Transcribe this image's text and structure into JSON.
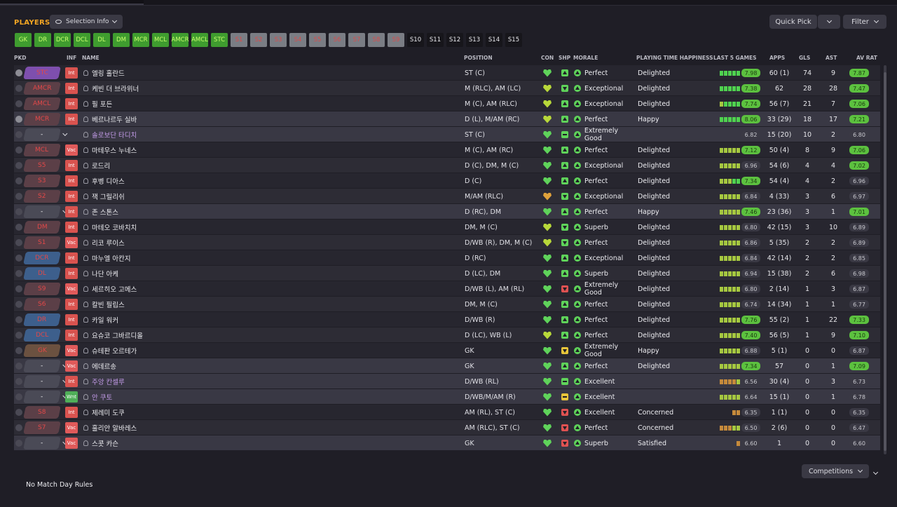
{
  "header": {
    "title": "PLAYERS",
    "selection_info": "Selection Info",
    "quick_pick": "Quick Pick",
    "filter": "Filter"
  },
  "position_chips": [
    {
      "label": "GK",
      "style": "green"
    },
    {
      "label": "DR",
      "style": "green"
    },
    {
      "label": "DCR",
      "style": "green"
    },
    {
      "label": "DCL",
      "style": "green"
    },
    {
      "label": "DL",
      "style": "green"
    },
    {
      "label": "DM",
      "style": "green"
    },
    {
      "label": "MCR",
      "style": "green"
    },
    {
      "label": "MCL",
      "style": "green"
    },
    {
      "label": "AMCR",
      "style": "green"
    },
    {
      "label": "AMCL",
      "style": "green"
    },
    {
      "label": "STC",
      "style": "green"
    },
    {
      "label": "S1",
      "style": "grey"
    },
    {
      "label": "S2",
      "style": "grey"
    },
    {
      "label": "S3",
      "style": "grey"
    },
    {
      "label": "S4",
      "style": "grey"
    },
    {
      "label": "S5",
      "style": "grey"
    },
    {
      "label": "S6",
      "style": "grey"
    },
    {
      "label": "S7",
      "style": "grey"
    },
    {
      "label": "S8",
      "style": "grey"
    },
    {
      "label": "S9",
      "style": "grey"
    },
    {
      "label": "S10",
      "style": "dark"
    },
    {
      "label": "S11",
      "style": "dark"
    },
    {
      "label": "S12",
      "style": "dark"
    },
    {
      "label": "S13",
      "style": "dark"
    },
    {
      "label": "S14",
      "style": "dark"
    },
    {
      "label": "S15",
      "style": "dark"
    }
  ],
  "columns": {
    "pkd": "PKD",
    "inf": "INF",
    "name": "NAME",
    "position": "POSITION",
    "con": "CON",
    "shp": "SHP",
    "morale": "MORALE",
    "happiness": "PLAYING TIME HAPPINESS",
    "last5": "LAST 5 GAMES",
    "apps": "APPS",
    "gls": "GLS",
    "ast": "AST",
    "avrat": "AV RAT"
  },
  "players": [
    {
      "pk": "on",
      "slot": "STC",
      "slot_color": "purple",
      "inf": "Int",
      "name": "엘링 홀란드",
      "pos": "ST (C)",
      "con": "g",
      "shp": "up",
      "morale": "Perfect",
      "happy": "Delighted",
      "form": "ggggg",
      "r5": "7.98",
      "r5g": true,
      "apps": "60 (1)",
      "gls": "74",
      "ast": "9",
      "avr": "7.87",
      "avrg": true,
      "bg": "row"
    },
    {
      "pk": "off",
      "slot": "AMCR",
      "slot_color": "maroon",
      "inf": "Int",
      "name": "케빈 더 브라위너",
      "pos": "M (RLC), AM (LC)",
      "con": "y",
      "shp": "dn",
      "morale": "Exceptional",
      "happy": "Delighted",
      "form": "ggggg",
      "r5": "7.38",
      "r5g": true,
      "apps": "62",
      "gls": "28",
      "ast": "28",
      "avr": "7.47",
      "avrg": true,
      "bg": "alt"
    },
    {
      "pk": "off",
      "slot": "AMCL",
      "slot_color": "maroon",
      "inf": "Int",
      "name": "필 포든",
      "pos": "M (C), AM (RLC)",
      "con": "y",
      "shp": "up",
      "morale": "Exceptional",
      "happy": "Delighted",
      "form": "lgggg",
      "r5": "7.74",
      "r5g": true,
      "apps": "56 (7)",
      "gls": "21",
      "ast": "7",
      "avr": "7.06",
      "avrg": true,
      "bg": "row"
    },
    {
      "pk": "on",
      "slot": "MCR",
      "slot_color": "maroon",
      "inf": "Int",
      "name": "베르나르두 실바",
      "pos": "D (L), M/AM (RC)",
      "con": "y",
      "shp": "up",
      "morale": "Perfect",
      "happy": "Happy",
      "form": "ggggg",
      "r5": "8.06",
      "r5g": true,
      "apps": "33 (29)",
      "gls": "18",
      "ast": "17",
      "avr": "7.21",
      "avrg": true,
      "bg": "hl"
    },
    {
      "pk": "off",
      "slot": "-",
      "slot_color": "slate",
      "inf": "",
      "name": "솔로보단 타디치",
      "pos": "ST (C)",
      "con": "g",
      "shp": "eq",
      "morale": "Extremely Good",
      "happy": "",
      "form": "xxxxx",
      "r5": "6.82",
      "r5g": false,
      "apps": "15 (20)",
      "gls": "10",
      "ast": "2",
      "avr": "6.80",
      "avrg": false,
      "bg": "hl",
      "purple_name": true
    },
    {
      "pk": "off",
      "slot": "MCL",
      "slot_color": "maroon",
      "inf": "Vac",
      "name": "마테우스 누네스",
      "pos": "M (C), AM (RC)",
      "con": "g",
      "shp": "up",
      "morale": "Perfect",
      "happy": "Delighted",
      "form": "lllll",
      "r5": "7.12",
      "r5g": true,
      "apps": "50 (4)",
      "gls": "8",
      "ast": "9",
      "avr": "7.06",
      "avrg": true,
      "bg": "row"
    },
    {
      "pk": "off",
      "slot": "S5",
      "slot_color": "maroon",
      "inf": "Int",
      "name": "로드리",
      "pos": "D (C), DM, M (C)",
      "con": "g",
      "shp": "up",
      "morale": "Exceptional",
      "happy": "Delighted",
      "form": "lllll",
      "r5": "6.96",
      "r5g": false,
      "apps": "54 (6)",
      "gls": "4",
      "ast": "4",
      "avr": "7.02",
      "avrg": true,
      "bg": "alt"
    },
    {
      "pk": "off",
      "slot": "S3",
      "slot_color": "maroon",
      "inf": "Int",
      "name": "후벵 디아스",
      "pos": "D (C)",
      "con": "g",
      "shp": "up",
      "morale": "Perfect",
      "happy": "Delighted",
      "form": "lllgg",
      "r5": "7.34",
      "r5g": true,
      "apps": "54 (4)",
      "gls": "4",
      "ast": "2",
      "avr": "6.96",
      "avrg": false,
      "bg": "row"
    },
    {
      "pk": "off",
      "slot": "S2",
      "slot_color": "maroon",
      "inf": "Int",
      "name": "잭 그릴리쉬",
      "pos": "M/AM (RLC)",
      "con": "o",
      "shp": "dn",
      "morale": "Exceptional",
      "happy": "Delighted",
      "form": "lllll",
      "r5": "6.84",
      "r5g": false,
      "apps": "4 (33)",
      "gls": "3",
      "ast": "6",
      "avr": "6.97",
      "avrg": false,
      "bg": "alt"
    },
    {
      "pk": "off",
      "slot": "-",
      "slot_color": "slate",
      "inf": "Int",
      "name": "존 스톤스",
      "pos": "D (RC), DM",
      "con": "g",
      "shp": "up",
      "morale": "Perfect",
      "happy": "Happy",
      "form": "lllll",
      "r5": "7.46",
      "r5g": true,
      "apps": "23 (36)",
      "gls": "3",
      "ast": "1",
      "avr": "7.01",
      "avrg": true,
      "bg": "hl"
    },
    {
      "pk": "off",
      "slot": "DM",
      "slot_color": "maroon",
      "inf": "Int",
      "name": "마테오 코바치치",
      "pos": "DM, M (C)",
      "con": "y",
      "shp": "dn",
      "morale": "Superb",
      "happy": "Delighted",
      "form": "lllll",
      "r5": "6.80",
      "r5g": false,
      "apps": "42 (15)",
      "gls": "3",
      "ast": "10",
      "avr": "6.89",
      "avrg": false,
      "bg": "row"
    },
    {
      "pk": "off",
      "slot": "S1",
      "slot_color": "maroon",
      "inf": "Vac",
      "name": "리코 루이스",
      "pos": "D/WB (R), DM, M (C)",
      "con": "y",
      "shp": "dn",
      "morale": "Perfect",
      "happy": "Delighted",
      "form": "lllll",
      "r5": "6.86",
      "r5g": false,
      "apps": "5 (35)",
      "gls": "2",
      "ast": "2",
      "avr": "6.89",
      "avrg": false,
      "bg": "alt"
    },
    {
      "pk": "off",
      "slot": "DCR",
      "slot_color": "blue",
      "inf": "Int",
      "name": "마누엘 아칸지",
      "pos": "D (RC)",
      "con": "g",
      "shp": "up",
      "morale": "Exceptional",
      "happy": "Delighted",
      "form": "lllll",
      "r5": "6.84",
      "r5g": false,
      "apps": "42 (14)",
      "gls": "2",
      "ast": "2",
      "avr": "6.85",
      "avrg": false,
      "bg": "row"
    },
    {
      "pk": "off",
      "slot": "DL",
      "slot_color": "blue",
      "inf": "Int",
      "name": "나단 아케",
      "pos": "D (LC), DM",
      "con": "g",
      "shp": "up",
      "morale": "Superb",
      "happy": "Delighted",
      "form": "lllll",
      "r5": "6.94",
      "r5g": false,
      "apps": "15 (38)",
      "gls": "2",
      "ast": "6",
      "avr": "6.98",
      "avrg": false,
      "bg": "alt"
    },
    {
      "pk": "off",
      "slot": "S9",
      "slot_color": "maroon",
      "inf": "Vac",
      "name": "세르히오 고메스",
      "pos": "D/WB (L), AM (RL)",
      "con": "g",
      "shp": "rdn",
      "morale": "Extremely Good",
      "happy": "Delighted",
      "form": "lllll",
      "r5": "6.80",
      "r5g": false,
      "apps": "2 (14)",
      "gls": "1",
      "ast": "3",
      "avr": "6.87",
      "avrg": false,
      "bg": "row"
    },
    {
      "pk": "off",
      "slot": "S6",
      "slot_color": "maroon",
      "inf": "Int",
      "name": "칼빈 필립스",
      "pos": "DM, M (C)",
      "con": "g",
      "shp": "up",
      "morale": "Perfect",
      "happy": "Delighted",
      "form": "lllll",
      "r5": "6.74",
      "r5g": false,
      "apps": "14 (34)",
      "gls": "1",
      "ast": "1",
      "avr": "6.77",
      "avrg": false,
      "bg": "alt"
    },
    {
      "pk": "off",
      "slot": "DR",
      "slot_color": "blue",
      "inf": "Int",
      "name": "카일 워커",
      "pos": "D/WB (R)",
      "con": "g",
      "shp": "up",
      "morale": "Perfect",
      "happy": "Delighted",
      "form": "lllll",
      "r5": "7.76",
      "r5g": true,
      "apps": "55 (2)",
      "gls": "1",
      "ast": "22",
      "avr": "7.33",
      "avrg": true,
      "bg": "row"
    },
    {
      "pk": "off",
      "slot": "DCL",
      "slot_color": "blue",
      "inf": "Int",
      "name": "요슈코 그바르디올",
      "pos": "D (LC), WB (L)",
      "con": "y",
      "shp": "up",
      "morale": "Perfect",
      "happy": "Delighted",
      "form": "lllll",
      "r5": "7.40",
      "r5g": true,
      "apps": "56 (5)",
      "gls": "1",
      "ast": "9",
      "avr": "7.10",
      "avrg": true,
      "bg": "alt"
    },
    {
      "pk": "off",
      "slot": "GK",
      "slot_color": "brown",
      "inf": "Vac",
      "name": "슈테판 오르테가",
      "pos": "GK",
      "con": "g",
      "shp": "ydn",
      "morale": "Extremely Good",
      "happy": "Happy",
      "form": "lllll",
      "r5": "6.88",
      "r5g": false,
      "apps": "5 (1)",
      "gls": "0",
      "ast": "0",
      "avr": "6.87",
      "avrg": false,
      "bg": "row"
    },
    {
      "pk": "off",
      "slot": "-",
      "slot_color": "slate",
      "inf": "Vac",
      "name": "에데르송",
      "pos": "GK",
      "con": "g",
      "shp": "up",
      "morale": "Perfect",
      "happy": "Delighted",
      "form": "lllll",
      "r5": "7.34",
      "r5g": true,
      "apps": "57",
      "gls": "0",
      "ast": "1",
      "avr": "7.09",
      "avrg": true,
      "bg": "hl"
    },
    {
      "pk": "off",
      "slot": "-",
      "slot_color": "slate",
      "inf": "Int",
      "name": "주앙 칸셀루",
      "pos": "D/WB (RL)",
      "con": "g",
      "shp": "eq",
      "morale": "Excellent",
      "happy": "",
      "form": "ooool",
      "r5": "6.56",
      "r5g": false,
      "apps": "30 (4)",
      "gls": "0",
      "ast": "3",
      "avr": "6.73",
      "avrg": false,
      "bg": "hl",
      "purple_name": true
    },
    {
      "pk": "off",
      "slot": "-",
      "slot_color": "slate",
      "inf": "Wnt",
      "name": "안 쿠토",
      "pos": "D/WB/M/AM (R)",
      "con": "g",
      "shp": "yeq",
      "morale": "Excellent",
      "happy": "",
      "form": "lllll",
      "r5": "6.64",
      "r5g": false,
      "apps": "15 (1)",
      "gls": "0",
      "ast": "1",
      "avr": "6.78",
      "avrg": false,
      "bg": "hl",
      "purple_name": true
    },
    {
      "pk": "off",
      "slot": "S8",
      "slot_color": "maroon",
      "inf": "Int",
      "name": "제레미 도쿠",
      "pos": "AM (RL), ST (C)",
      "con": "g",
      "shp": "rdn",
      "morale": "Excellent",
      "happy": "Concerned",
      "form": "xxxoo",
      "r5": "6.35",
      "r5g": false,
      "apps": "1 (1)",
      "gls": "0",
      "ast": "0",
      "avr": "6.35",
      "avrg": false,
      "bg": "row"
    },
    {
      "pk": "off",
      "slot": "S7",
      "slot_color": "maroon",
      "inf": "Vac",
      "name": "훌리안 알바레스",
      "pos": "AM (RLC), ST (C)",
      "con": "g",
      "shp": "rdn",
      "morale": "Perfect",
      "happy": "Concerned",
      "form": "rooll",
      "r5": "6.50",
      "r5g": false,
      "apps": "2 (6)",
      "gls": "0",
      "ast": "0",
      "avr": "6.47",
      "avrg": false,
      "bg": "alt"
    },
    {
      "pk": "off",
      "slot": "-",
      "slot_color": "slate",
      "inf": "Vac",
      "name": "스콧 카슨",
      "pos": "GK",
      "con": "g",
      "shp": "rdn",
      "morale": "Superb",
      "happy": "Satisfied",
      "form": "xxxxo",
      "r5": "6.60",
      "r5g": false,
      "apps": "1",
      "gls": "0",
      "ast": "0",
      "avr": "6.60",
      "avrg": false,
      "bg": "hl"
    }
  ],
  "footer": {
    "rules": "No Match Day Rules",
    "competitions": "Competitions"
  }
}
